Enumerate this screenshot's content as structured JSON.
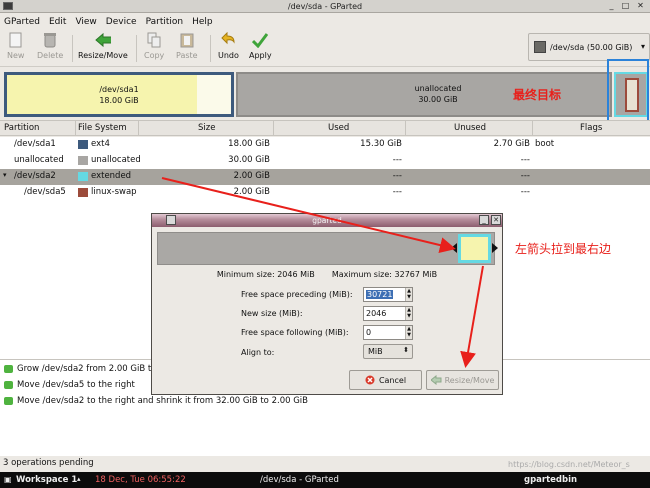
{
  "window": {
    "title": "/dev/sda - GParted"
  },
  "menubar": [
    {
      "label": "GParted"
    },
    {
      "label": "Edit"
    },
    {
      "label": "View"
    },
    {
      "label": "Device"
    },
    {
      "label": "Partition"
    },
    {
      "label": "Help"
    }
  ],
  "toolbar": {
    "new": "New",
    "delete": "Delete",
    "resize_move": "Resize/Move",
    "copy": "Copy",
    "paste": "Paste",
    "undo": "Undo",
    "apply": "Apply",
    "device": "/dev/sda   (50.00 GiB)"
  },
  "visual": {
    "p1_name": "/dev/sda1",
    "p1_size": "18.00 GiB",
    "unalloc_name": "unallocated",
    "unalloc_size": "30.00 GiB",
    "annotation_target": "最终目标"
  },
  "columns": [
    "Partition",
    "File System",
    "Size",
    "Used",
    "Unused",
    "Flags"
  ],
  "rows": [
    {
      "partition": "/dev/sda1",
      "fs": "ext4",
      "size": "18.00 GiB",
      "used": "15.30 GiB",
      "unused": "2.70 GiB",
      "flags": "boot",
      "color": "#3d5a7d"
    },
    {
      "partition": "unallocated",
      "fs": "unallocated",
      "size": "30.00 GiB",
      "used": "---",
      "unused": "---",
      "flags": "",
      "color": "#a8a6a3"
    },
    {
      "partition": "/dev/sda2",
      "fs": "extended",
      "size": "2.00 GiB",
      "used": "---",
      "unused": "---",
      "flags": "",
      "color": "#65d9e3"
    },
    {
      "partition": "/dev/sda5",
      "fs": "linux-swap",
      "size": "2.00 GiB",
      "used": "---",
      "unused": "---",
      "flags": "",
      "color": "#9c4b3b"
    }
  ],
  "operations": [
    "Grow /dev/sda2 from 2.00 GiB to",
    "Move /dev/sda5 to the right",
    "Move /dev/sda2 to the right and shrink it from 32.00 GiB to 2.00 GiB"
  ],
  "status": "3 operations pending",
  "taskbar": {
    "workspace": "Workspace 1",
    "datetime": "18 Dec, Tue 06:55:22",
    "task1": "/dev/sda - GParted",
    "task2": "gpartedbin",
    "watermark": "https://blog.csdn.net/Meteor_s"
  },
  "dialog": {
    "title": "gparted",
    "min_size": "Minimum size: 2046 MiB",
    "max_size": "Maximum size: 32767 MiB",
    "free_preceding_label": "Free space preceding (MiB):",
    "free_preceding_value": "30721",
    "new_size_label": "New size (MiB):",
    "new_size_value": "2046",
    "free_following_label": "Free space following (MiB):",
    "free_following_value": "0",
    "align_label": "Align to:",
    "align_value": "MiB",
    "cancel": "Cancel",
    "resize_move": "Resize/Move",
    "annotation": "左箭头拉到最右边"
  }
}
